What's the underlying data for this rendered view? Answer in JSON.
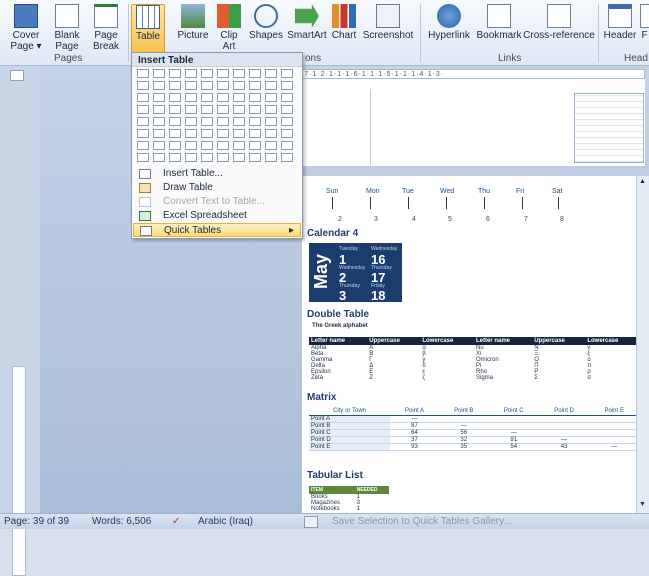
{
  "ribbon": {
    "pages_group": {
      "label": "Pages",
      "cover": "Cover Page ▾",
      "blank": "Blank Page",
      "break": "Page Break"
    },
    "table_button": "Table",
    "picture": "Picture",
    "clip": "Clip Art",
    "shapes": "Shapes",
    "smartart": "SmartArt",
    "chart": "Chart",
    "screenshot": "Screenshot",
    "links_group": {
      "label": "Links",
      "hyperlink": "Hyperlink",
      "bookmark": "Bookmark",
      "crossref": "Cross-reference"
    },
    "header": "Header",
    "f": "F",
    "head_label": "Head",
    "illus_label": "ons"
  },
  "menu": {
    "title": "Insert Table",
    "items": [
      {
        "label": "Insert Table...",
        "disabled": false
      },
      {
        "label": "Draw Table",
        "disabled": false
      },
      {
        "label": "Convert Text to Table...",
        "disabled": true
      },
      {
        "label": "Excel Spreadsheet",
        "disabled": false
      },
      {
        "label": "Quick Tables",
        "disabled": false,
        "submenu": "▸"
      }
    ]
  },
  "gallery": {
    "calendar_days": [
      "Sun",
      "Mon",
      "Tue",
      "Wed",
      "Thu",
      "Fri",
      "Sat"
    ],
    "calendar_nums": [
      "2",
      "3",
      "4",
      "5",
      "6",
      "7",
      "8"
    ],
    "cal4_title": "Calendar 4",
    "may": {
      "month": "May",
      "d1n": "Tuesday",
      "d1": "1",
      "d2n": "Wednesday",
      "d2": "16",
      "d3n": "Wednesday",
      "d3": "2",
      "d4n": "Thursday",
      "d4": "17",
      "d5n": "Thursday",
      "d5": "3",
      "d6n": "Friday",
      "d6": "18"
    },
    "double_title": "Double Table",
    "greek_caption": "The Greek alphabet",
    "greek_headers": [
      "Letter name",
      "Uppercase",
      "Lowercase",
      "Letter name",
      "Uppercase",
      "Lowercase"
    ],
    "greek_rows": [
      [
        "Alpha",
        "A",
        "α",
        "Nu",
        "N",
        "ν"
      ],
      [
        "Beta",
        "B",
        "β",
        "Xi",
        "Ξ",
        "ξ"
      ],
      [
        "Gamma",
        "Γ",
        "γ",
        "Omicron",
        "O",
        "ο"
      ],
      [
        "Delta",
        "Δ",
        "δ",
        "Pi",
        "Π",
        "π"
      ],
      [
        "Epsilon",
        "E",
        "ε",
        "Rho",
        "P",
        "ρ"
      ],
      [
        "Zeta",
        "Z",
        "ζ",
        "Sigma",
        "Σ",
        "σ"
      ]
    ],
    "matrix_title": "Matrix",
    "matrix_headers": [
      "City or Town",
      "Point A",
      "Point B",
      "Point C",
      "Point D",
      "Point E"
    ],
    "matrix_rows": [
      [
        "Point A",
        "—",
        "",
        "",
        "",
        ""
      ],
      [
        "Point B",
        "87",
        "—",
        "",
        "",
        ""
      ],
      [
        "Point C",
        "64",
        "56",
        "—",
        "",
        ""
      ],
      [
        "Point D",
        "37",
        "32",
        "91",
        "—",
        ""
      ],
      [
        "Point E",
        "93",
        "35",
        "54",
        "43",
        "—"
      ]
    ],
    "tabular_title": "Tabular List",
    "tabular_headers": [
      "ITEM",
      "NEEDED"
    ],
    "tabular_rows": [
      [
        "Books",
        "1"
      ],
      [
        "Magazines",
        "3"
      ],
      [
        "Notebooks",
        "1"
      ]
    ],
    "save_selection": "Save Selection to Quick Tables Gallery..."
  },
  "status": {
    "page": "Page: 39 of 39",
    "words": "Words: 6,506",
    "lang": "Arabic (Iraq)"
  },
  "colors": {
    "accent": "#1b3d6e",
    "highlight": "#ffd978"
  }
}
